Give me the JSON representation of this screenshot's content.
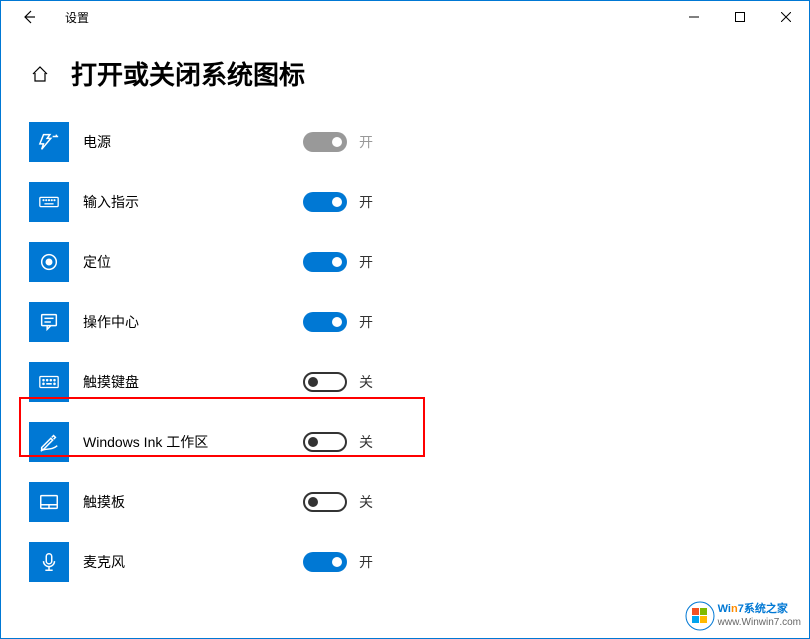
{
  "window": {
    "title": "设置"
  },
  "page": {
    "title": "打开或关闭系统图标"
  },
  "labels": {
    "on": "开",
    "off": "关"
  },
  "settings": [
    {
      "icon": "power-icon",
      "label": "电源",
      "state": "on",
      "disabled": true
    },
    {
      "icon": "keyboard-icon",
      "label": "输入指示",
      "state": "on",
      "disabled": false
    },
    {
      "icon": "location-icon",
      "label": "定位",
      "state": "on",
      "disabled": false
    },
    {
      "icon": "action-center-icon",
      "label": "操作中心",
      "state": "on",
      "disabled": false
    },
    {
      "icon": "touch-keyboard-icon",
      "label": "触摸键盘",
      "state": "off",
      "disabled": false
    },
    {
      "icon": "ink-icon",
      "label": "Windows Ink 工作区",
      "state": "off",
      "disabled": false
    },
    {
      "icon": "touchpad-icon",
      "label": "触摸板",
      "state": "off",
      "disabled": false
    },
    {
      "icon": "mic-icon",
      "label": "麦克风",
      "state": "on",
      "disabled": false
    }
  ],
  "watermark": {
    "brand_prefix": "Wi",
    "brand_mid": "n",
    "brand_suffix": "7系统之家",
    "url": "www.Winwin7.com"
  }
}
